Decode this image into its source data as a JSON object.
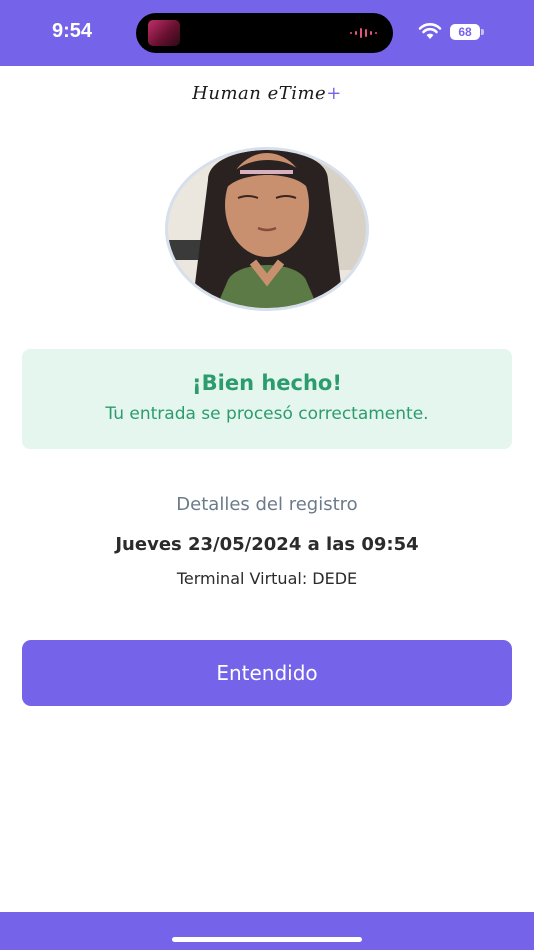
{
  "status_bar": {
    "time": "9:54",
    "battery": "68",
    "background": "#7564ea",
    "icons": [
      "wifi-icon",
      "battery-icon",
      "audio-wave-icon"
    ]
  },
  "logo": {
    "text": "Human eTime",
    "plus": "+"
  },
  "success": {
    "title": "¡Bien hecho!",
    "message": "Tu entrada se procesó correctamente.",
    "color": "#2c9c6e",
    "background": "#e4f6ee"
  },
  "details": {
    "heading": "Detalles del registro",
    "datetime": "Jueves 23/05/2024 a las 09:54",
    "terminal": "Terminal Virtual:  DEDE"
  },
  "actions": {
    "confirm_label": "Entendido",
    "accent": "#7564ea"
  }
}
